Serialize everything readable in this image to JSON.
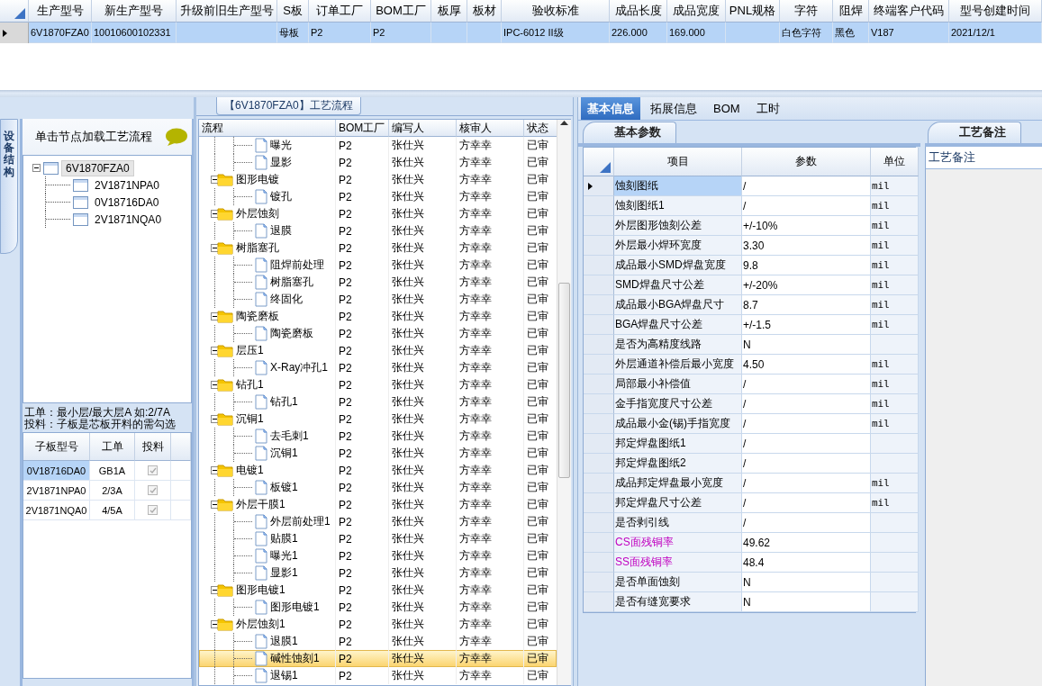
{
  "top_grid": {
    "columns": [
      "生产型号",
      "新生产型号",
      "升级前旧生产型号",
      "S板",
      "订单工厂",
      "BOM工厂",
      "板厚",
      "板材",
      "验收标准",
      "成品长度",
      "成品宽度",
      "PNL规格",
      "字符",
      "阻焊",
      "终端客户代码",
      "型号创建时间"
    ],
    "rows": [
      {
        "selected": true,
        "cells": [
          "6V1870FZA0",
          "10010600102331",
          null,
          "母板",
          "P2",
          "P2",
          null,
          null,
          "IPC-6012 II级",
          "226.000",
          "169.000",
          null,
          "白色字符",
          "黑色",
          "V187",
          "2021/12/1"
        ]
      }
    ]
  },
  "side_tab": {
    "label": "设备结构"
  },
  "structure": {
    "hint": "单击节点加载工艺流程",
    "tree": [
      {
        "label": "6V1870FZA0",
        "expanded": true,
        "selected": true,
        "children": [
          {
            "label": "2V1871NPA0",
            "selected": false
          },
          {
            "label": "0V18716DA0",
            "selected": false
          },
          {
            "label": "2V1871NQA0",
            "selected": false
          }
        ]
      }
    ]
  },
  "notes": [
    "工单：最小层/最大层A 如:2/7A",
    "投料：子板是芯板开料的需勾选"
  ],
  "sub_boards": {
    "columns": [
      "子板型号",
      "工单",
      "投料"
    ],
    "rows": [
      {
        "cells": [
          "0V18716DA0",
          "GB1A"
        ],
        "checked": true,
        "disabled": true,
        "selected": true
      },
      {
        "cells": [
          "2V1871NPA0",
          "2/3A"
        ],
        "checked": true,
        "disabled": true,
        "selected": false
      },
      {
        "cells": [
          "2V1871NQA0",
          "4/5A"
        ],
        "checked": true,
        "disabled": true,
        "selected": false
      }
    ]
  },
  "flow": {
    "title": "【6V1870FZA0】工艺流程",
    "columns": [
      "流程",
      "BOM工厂",
      "编写人",
      "核审人",
      "状态"
    ],
    "rows": [
      {
        "children": [
          {
            "kind": "step",
            "label": "曝光",
            "bom": "P2",
            "writer": "张仕兴",
            "reviewer": "方幸幸",
            "status": "已审",
            "selected": false
          },
          {
            "kind": "step",
            "label": "显影",
            "bom": "P2",
            "writer": "张仕兴",
            "reviewer": "方幸幸",
            "status": "已审",
            "selected": false
          }
        ]
      },
      {
        "kind": "folder",
        "label": "图形电镀",
        "expanded": true,
        "bom": "P2",
        "writer": "张仕兴",
        "reviewer": "方幸幸",
        "status": "已审",
        "selected": false,
        "children": [
          {
            "kind": "step",
            "label": "镀孔",
            "bom": "P2",
            "writer": "张仕兴",
            "reviewer": "方幸幸",
            "status": "已审",
            "selected": false
          }
        ]
      },
      {
        "kind": "folder",
        "label": "外层蚀刻",
        "expanded": true,
        "bom": "P2",
        "writer": "张仕兴",
        "reviewer": "方幸幸",
        "status": "已审",
        "selected": false,
        "children": [
          {
            "kind": "step",
            "label": "退膜",
            "bom": "P2",
            "writer": "张仕兴",
            "reviewer": "方幸幸",
            "status": "已审",
            "selected": false
          }
        ]
      },
      {
        "kind": "folder",
        "label": "树脂塞孔",
        "expanded": true,
        "bom": "P2",
        "writer": "张仕兴",
        "reviewer": "方幸幸",
        "status": "已审",
        "selected": false,
        "children": [
          {
            "kind": "step",
            "label": "阻焊前处理",
            "bom": "P2",
            "writer": "张仕兴",
            "reviewer": "方幸幸",
            "status": "已审",
            "selected": false
          },
          {
            "kind": "step",
            "label": "树脂塞孔",
            "bom": "P2",
            "writer": "张仕兴",
            "reviewer": "方幸幸",
            "status": "已审",
            "selected": false
          },
          {
            "kind": "step",
            "label": "终固化",
            "bom": "P2",
            "writer": "张仕兴",
            "reviewer": "方幸幸",
            "status": "已审",
            "selected": false
          }
        ]
      },
      {
        "kind": "folder",
        "label": "陶瓷磨板",
        "expanded": true,
        "bom": "P2",
        "writer": "张仕兴",
        "reviewer": "方幸幸",
        "status": "已审",
        "selected": false,
        "children": [
          {
            "kind": "step",
            "label": "陶瓷磨板",
            "bom": "P2",
            "writer": "张仕兴",
            "reviewer": "方幸幸",
            "status": "已审",
            "selected": false
          }
        ]
      },
      {
        "kind": "folder",
        "label": "层压1",
        "expanded": true,
        "bom": "P2",
        "writer": "张仕兴",
        "reviewer": "方幸幸",
        "status": "已审",
        "selected": false,
        "children": [
          {
            "kind": "step",
            "label": "X-Ray冲孔1",
            "bom": "P2",
            "writer": "张仕兴",
            "reviewer": "方幸幸",
            "status": "已审",
            "selected": false
          }
        ]
      },
      {
        "kind": "folder",
        "label": "钻孔1",
        "expanded": true,
        "bom": "P2",
        "writer": "张仕兴",
        "reviewer": "方幸幸",
        "status": "已审",
        "selected": false,
        "children": [
          {
            "kind": "step",
            "label": "钻孔1",
            "bom": "P2",
            "writer": "张仕兴",
            "reviewer": "方幸幸",
            "status": "已审",
            "selected": false
          }
        ]
      },
      {
        "kind": "folder",
        "label": "沉铜1",
        "expanded": true,
        "bom": "P2",
        "writer": "张仕兴",
        "reviewer": "方幸幸",
        "status": "已审",
        "selected": false,
        "children": [
          {
            "kind": "step",
            "label": "去毛刺1",
            "bom": "P2",
            "writer": "张仕兴",
            "reviewer": "方幸幸",
            "status": "已审",
            "selected": false
          },
          {
            "kind": "step",
            "label": "沉铜1",
            "bom": "P2",
            "writer": "张仕兴",
            "reviewer": "方幸幸",
            "status": "已审",
            "selected": false
          }
        ]
      },
      {
        "kind": "folder",
        "label": "电镀1",
        "expanded": true,
        "bom": "P2",
        "writer": "张仕兴",
        "reviewer": "方幸幸",
        "status": "已审",
        "selected": false,
        "children": [
          {
            "kind": "step",
            "label": "板镀1",
            "bom": "P2",
            "writer": "张仕兴",
            "reviewer": "方幸幸",
            "status": "已审",
            "selected": false
          }
        ]
      },
      {
        "kind": "folder",
        "label": "外层干膜1",
        "expanded": true,
        "bom": "P2",
        "writer": "张仕兴",
        "reviewer": "方幸幸",
        "status": "已审",
        "selected": false,
        "children": [
          {
            "kind": "step",
            "label": "外层前处理1",
            "bom": "P2",
            "writer": "张仕兴",
            "reviewer": "方幸幸",
            "status": "已审",
            "selected": false
          },
          {
            "kind": "step",
            "label": "贴膜1",
            "bom": "P2",
            "writer": "张仕兴",
            "reviewer": "方幸幸",
            "status": "已审",
            "selected": false
          },
          {
            "kind": "step",
            "label": "曝光1",
            "bom": "P2",
            "writer": "张仕兴",
            "reviewer": "方幸幸",
            "status": "已审",
            "selected": false
          },
          {
            "kind": "step",
            "label": "显影1",
            "bom": "P2",
            "writer": "张仕兴",
            "reviewer": "方幸幸",
            "status": "已审",
            "selected": false
          }
        ]
      },
      {
        "kind": "folder",
        "label": "图形电镀1",
        "expanded": true,
        "bom": "P2",
        "writer": "张仕兴",
        "reviewer": "方幸幸",
        "status": "已审",
        "selected": false,
        "children": [
          {
            "kind": "step",
            "label": "图形电镀1",
            "bom": "P2",
            "writer": "张仕兴",
            "reviewer": "方幸幸",
            "status": "已审",
            "selected": false
          }
        ]
      },
      {
        "kind": "folder",
        "label": "外层蚀刻1",
        "expanded": true,
        "bom": "P2",
        "writer": "张仕兴",
        "reviewer": "方幸幸",
        "status": "已审",
        "selected": false,
        "children": [
          {
            "kind": "step",
            "label": "退膜1",
            "bom": "P2",
            "writer": "张仕兴",
            "reviewer": "方幸幸",
            "status": "已审",
            "selected": false
          },
          {
            "kind": "step",
            "label": "碱性蚀刻1",
            "bom": "P2",
            "writer": "张仕兴",
            "reviewer": "方幸幸",
            "status": "已审",
            "selected": true
          },
          {
            "kind": "step",
            "label": "退锡1",
            "bom": "P2",
            "writer": "张仕兴",
            "reviewer": "方幸幸",
            "status": "已审",
            "selected": false
          }
        ]
      }
    ]
  },
  "detail": {
    "tabs": [
      {
        "label": "基本信息",
        "selected": true
      },
      {
        "label": "拓展信息",
        "selected": false
      },
      {
        "label": "BOM",
        "selected": false
      },
      {
        "label": "工时",
        "selected": false
      }
    ],
    "section_tab": "基本参数",
    "params": {
      "columns": [
        "项目",
        "参数",
        "单位"
      ],
      "rows": [
        {
          "item": "蚀刻图纸",
          "value": "/",
          "unit": "mil",
          "selected": true
        },
        {
          "item": "蚀刻图纸1",
          "value": "/",
          "unit": "mil",
          "selected": false
        },
        {
          "item": "外层图形蚀刻公差",
          "value": "+/-10%",
          "unit": "mil",
          "selected": false
        },
        {
          "item": "外层最小焊环宽度",
          "value": "3.30",
          "unit": "mil",
          "selected": false
        },
        {
          "item": "成品最小SMD焊盘宽度",
          "value": "9.8",
          "unit": "mil",
          "selected": false
        },
        {
          "item": "SMD焊盘尺寸公差",
          "value": "+/-20%",
          "unit": "mil",
          "selected": false
        },
        {
          "item": "成品最小BGA焊盘尺寸",
          "value": "8.7",
          "unit": "mil",
          "selected": false
        },
        {
          "item": "BGA焊盘尺寸公差",
          "value": "+/-1.5",
          "unit": "mil",
          "selected": false
        },
        {
          "item": "是否为高精度线路",
          "value": "N",
          "selected": false
        },
        {
          "item": "外层通道补偿后最小宽度",
          "value": "4.50",
          "unit": "mil",
          "selected": false
        },
        {
          "item": "局部最小补偿值",
          "value": "/",
          "unit": "mil",
          "selected": false
        },
        {
          "item": "金手指宽度尺寸公差",
          "value": "/",
          "unit": "mil",
          "selected": false
        },
        {
          "item": "成品最小金(锡)手指宽度",
          "value": "/",
          "unit": "mil",
          "selected": false
        },
        {
          "item": "邦定焊盘图纸1",
          "value": "/",
          "selected": false
        },
        {
          "item": "邦定焊盘图纸2",
          "value": "/",
          "selected": false
        },
        {
          "item": "成品邦定焊盘最小宽度",
          "value": "/",
          "unit": "mil",
          "selected": false
        },
        {
          "item": "邦定焊盘尺寸公差",
          "value": "/",
          "unit": "mil",
          "selected": false
        },
        {
          "item": "是否剥引线",
          "value": "/",
          "selected": false
        },
        {
          "item": "CS面残铜率",
          "value": "49.62",
          "color": "#c000c0",
          "selected": false
        },
        {
          "item": "SS面残铜率",
          "value": "48.4",
          "color": "#c000c0",
          "selected": false
        },
        {
          "item": "是否单面蚀刻",
          "value": "N",
          "selected": false
        },
        {
          "item": "是否有缝宽要求",
          "value": "N",
          "selected": false
        }
      ]
    },
    "remarks": {
      "tab": "工艺备注",
      "label": "工艺备注"
    }
  }
}
